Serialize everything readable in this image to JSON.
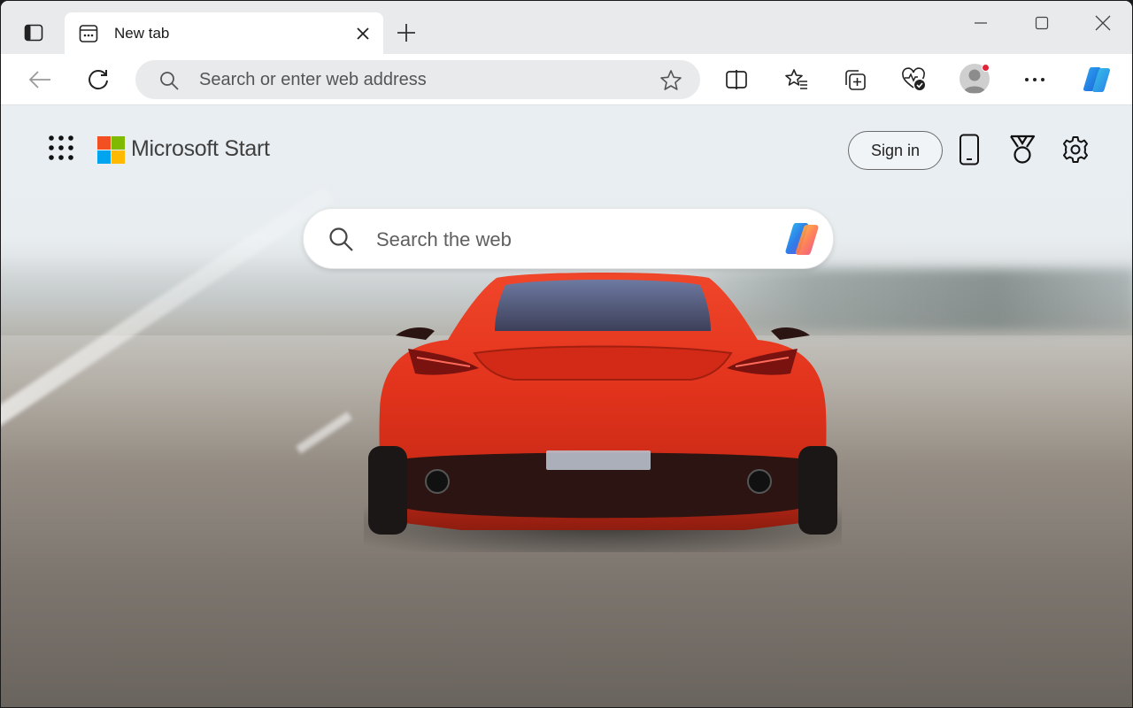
{
  "browser": {
    "tab": {
      "title": "New tab"
    },
    "address_bar": {
      "placeholder": "Search or enter web address"
    }
  },
  "start_page": {
    "brand": "Microsoft Start",
    "sign_in_label": "Sign in",
    "search": {
      "placeholder": "Search the web"
    },
    "logo_colors": [
      "#f25022",
      "#7fba00",
      "#00a4ef",
      "#ffb900"
    ]
  },
  "icons": {
    "tab_actions": "tab-actions-icon",
    "favicon": "new-tab-page-icon",
    "close": "close-icon",
    "new_tab": "plus-icon",
    "back": "back-arrow-icon",
    "refresh": "refresh-icon",
    "search": "search-icon",
    "favorite": "star-icon",
    "split_screen": "split-screen-icon",
    "favorites": "favorites-icon",
    "collections": "collections-icon",
    "browser_essentials": "heart-check-icon",
    "profile": "profile-avatar-icon",
    "more": "ellipsis-icon",
    "copilot": "copilot-icon",
    "apps": "app-launcher-grid-icon",
    "phone": "phone-icon",
    "rewards": "rewards-medal-icon",
    "settings": "gear-icon"
  }
}
